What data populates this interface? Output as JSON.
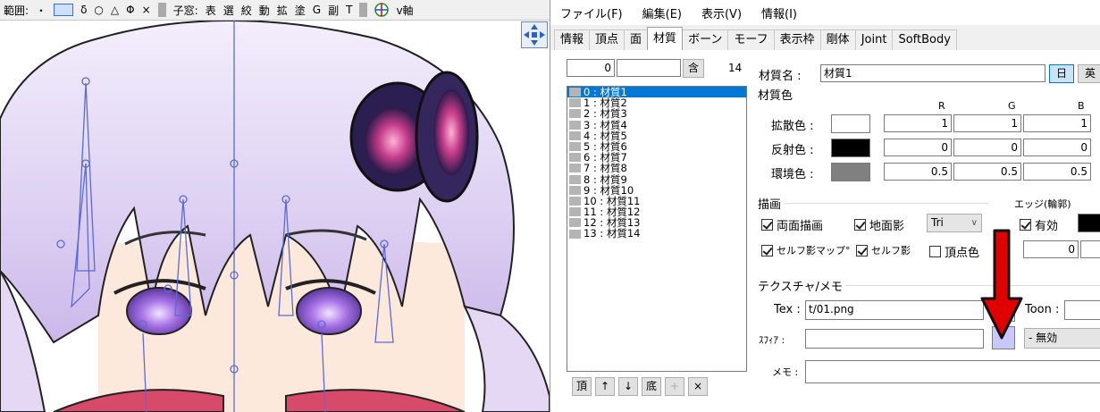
{
  "viewport": {
    "toolbar": {
      "range_label": "範囲:",
      "tools": [
        "・",
        "□",
        "δ",
        "○",
        "△",
        "Φ",
        "×"
      ],
      "child_window_label": "子窓:",
      "child_items": [
        "表",
        "選",
        "絞",
        "動",
        "拡",
        "塗",
        "G",
        "副",
        "T"
      ],
      "axis_label": "v軸"
    }
  },
  "menu": [
    "ファイル(F)",
    "編集(E)",
    "表示(V)",
    "情報(I)"
  ],
  "tabs": [
    "情報",
    "頂点",
    "面",
    "材質",
    "ボーン",
    "モーフ",
    "表示枠",
    "剛体",
    "Joint",
    "SoftBody"
  ],
  "active_tab": "材質",
  "list": {
    "index_value": "0",
    "search_value": "",
    "include_button": "含",
    "count": "14",
    "items": [
      "0 : 材質1",
      "1 : 材質2",
      "2 : 材質3",
      "3 : 材質4",
      "4 : 材質5",
      "5 : 材質6",
      "6 : 材質7",
      "7 : 材質8",
      "8 : 材質9",
      "9 : 材質10",
      "10 : 材質11",
      "11 : 材質12",
      "12 : 材質13",
      "13 : 材質14"
    ],
    "selected_index": 0,
    "buttons": [
      "頂",
      "↑",
      "↓",
      "底",
      "+",
      "×"
    ]
  },
  "material": {
    "name_label": "材質名 :",
    "name_value": "材質1",
    "lang_jp": "日",
    "lang_en": "英",
    "color_group": "材質色",
    "headers": [
      "R",
      "G",
      "B"
    ],
    "rows": [
      {
        "label": "拡散色 :",
        "swatch": "#ffffff",
        "values": [
          "1",
          "1",
          "1"
        ]
      },
      {
        "label": "反射色 :",
        "swatch": "#000000",
        "values": [
          "0",
          "0",
          "0"
        ]
      },
      {
        "label": "環境色 :",
        "swatch": "#808080",
        "values": [
          "0.5",
          "0.5",
          "0.5"
        ]
      }
    ]
  },
  "drawing": {
    "group": "描画",
    "double_sided": "両面描画",
    "ground_shadow": "地面影",
    "combo_value": "Tri",
    "self_shadow_map": "セルフ影マップ°",
    "self_shadow": "セルフ影",
    "vertex_color": "頂点色"
  },
  "edge": {
    "group": "エッジ(輪郭)",
    "enabled": "有効",
    "color": "#000000",
    "size_value": "0"
  },
  "texture": {
    "group": "テクスチャ/メモ",
    "tex_label": "Tex :",
    "tex_value": "t/01.png",
    "tex_swatch": "#ccffff",
    "toon_label": "Toon :",
    "toon_value": "",
    "sphere_label": "ｽﾌｨｱ :",
    "sphere_value": "",
    "sphere_swatch": "#c8c8ff",
    "sphere_mode": "- 無効",
    "memo_label": "メモ :",
    "memo_value": ""
  },
  "annotation": {
    "arrow_color": "#e00000"
  }
}
